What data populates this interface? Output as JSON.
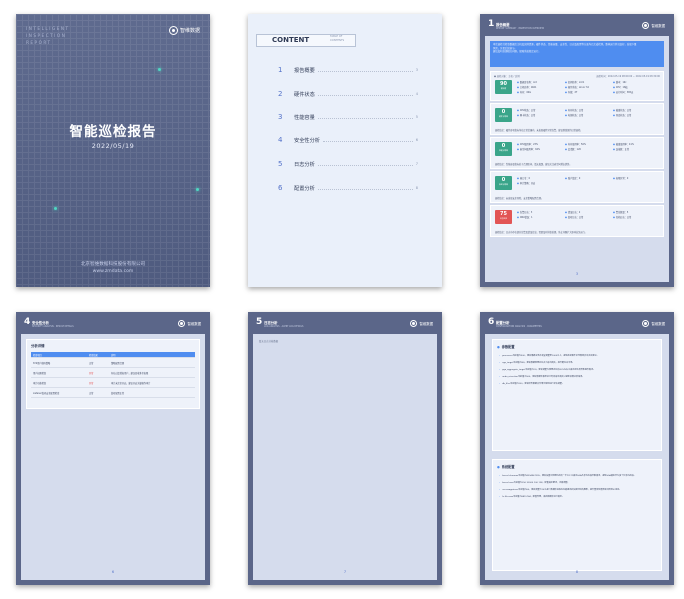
{
  "cover": {
    "en_lines": [
      "INTELLIGENT",
      "INSPECTION",
      "REPORT"
    ],
    "logo": "智维数据",
    "title": "智能巡检报告",
    "date": "2022/05/19",
    "company": "北京智维数据科技股份有限公司",
    "website": "www.zmdata.com"
  },
  "toc": {
    "heading": "CONTENT",
    "heading_sub": [
      "TABLE OF",
      "CONTENTS"
    ],
    "items": [
      {
        "num": "1",
        "label": "报告概要",
        "page": "3"
      },
      {
        "num": "2",
        "label": "硬件状态",
        "page": "4"
      },
      {
        "num": "3",
        "label": "性能容量",
        "page": "5"
      },
      {
        "num": "4",
        "label": "安全性分析",
        "page": "6"
      },
      {
        "num": "5",
        "label": "日志分析",
        "page": "7"
      },
      {
        "num": "6",
        "label": "配置分析",
        "page": "8"
      }
    ]
  },
  "page3": {
    "num": "1",
    "title": "报告概要",
    "subtitle": "REPORT SUMMARY · INSPECTION OVERVIEW",
    "logo": "智维数据",
    "summary": [
      "本次巡检共检查数据库主机及实例资源，硬件状态、性能容量、安全性、日志及配置等方面均已完成检测，整体运行状况良好，发现少量",
      "风险，详见后续章节。",
      "建议及时处理相关问题，保障系统稳定运行。"
    ],
    "top_line": "● 巡检对象：主机 / 实例",
    "top_right": "巡检时间：2022-05-19 08:00:00 ~ 2022-05-19 08:30:00",
    "cards": [
      {
        "badge": "90",
        "badge_label": "健康度",
        "color": "#3aa58a",
        "kv": [
          "数据库名称：orcl",
          "实例名称：orcl1",
          "版本：19c",
          "主机名称：db01",
          "操作系统：Linux 7.6",
          "CPU：16核",
          "内存：64G",
          "存储：2T",
          "运行时间：365天"
        ],
        "note": ""
      },
      {
        "badge": "0",
        "badge_label": "硬件异常数",
        "color": "#3aa58a",
        "kv": [
          "CPU状态：正常",
          "内存状态：正常",
          "磁盘状态：正常",
          "网卡状态：正常",
          "电源状态：正常",
          "风扇状态：正常"
        ],
        "note": "巡检结论：硬件各项指标均在正常范围内，未发现硬件异常告警，建议继续保持日常巡检。"
      },
      {
        "badge": "0",
        "badge_label": "性能异常数",
        "color": "#3aa58a",
        "kv": [
          "CPU使用率：23%",
          "内存使用率：56%",
          "磁盘使用率：41%",
          "表空间使用率：62%",
          "会话数：120",
          "连接数：正常"
        ],
        "note": "巡检结论：性能容量指标处于合理区间，暂无瓶颈，建议关注表空间增长趋势。"
      },
      {
        "badge": "0",
        "badge_label": "安全异常数",
        "color": "#3aa58a",
        "kv": [
          "弱口令：0",
          "账户锁定：0",
          "权限异常：0",
          "审计策略：开启"
        ],
        "note": "巡检结论：未发现安全风险，安全策略配置合理。"
      },
      {
        "badge": "75",
        "badge_label": "日志风险",
        "color": "#e25555",
        "kv": [
          "告警日志：3",
          "错误日志：2",
          "警告数量：5",
          "ORA错误：1",
          "监听日志：正常",
          "归档日志：正常"
        ],
        "note": "巡检结论：日志中存在部分告警及错误信息，需要及时排查处理，防止问题扩大影响业务运行。"
      }
    ],
    "page": "3"
  },
  "page4": {
    "num": "4",
    "title": "安全性分析",
    "subtitle": "SECURITY ANALYSIS · RESULT DETAILS",
    "logo": "智维数据",
    "table_title": "分析详情",
    "columns": [
      "检查项目",
      "检查结果",
      "说明"
    ],
    "rows": [
      {
        "item": "SYS用户密码策略",
        "result": "正常",
        "bad": false,
        "desc": "策略配置合理"
      },
      {
        "item": "用户权限检查",
        "result": "异常",
        "bad": true,
        "desc": "存在过度授权用户，建议回收多余权限"
      },
      {
        "item": "审计功能检查",
        "result": "异常",
        "bad": true,
        "desc": "审计未完全开启，建议开启关键操作审计"
      },
      {
        "item": "Listener监听安全配置检查",
        "result": "正常",
        "bad": false,
        "desc": "监听配置正常"
      }
    ],
    "page": "6"
  },
  "page5": {
    "num": "5",
    "title": "日志分析",
    "subtitle": "LOG ANALYSIS · ALERT LOG DETAILS",
    "logo": "智维数据",
    "note": "暂无日志分析数据",
    "page": "7"
  },
  "page6": {
    "num": "6",
    "title": "配置分析",
    "subtitle": "CONFIGURATION ANALYSIS · PARAMETERS",
    "logo": "智维数据",
    "sec1_title": "参数配置",
    "sec1_lines": [
      "processes当前值为300，建议根据业务并发量调整至1000以上，避免连接数不足导致新会话无法建立。",
      "sga_target当前值为8G，建议根据物理内存大小适当调大，提升缓存命中率。",
      "pga_aggregate_target当前值为2G，建议调整为物理内存的20%左右以满足排序及哈希操作需求。",
      "undo_retention当前值为900，建议根据长事务运行时间适当调大以避免快照过旧错误。",
      "db_files当前值为200，建议结合数据文件增长规划进行评估调整。"
    ],
    "sec2_title": "系统配置",
    "sec2_lines": [
      "kernel.shmmax当前值为4294967295，建议设置为物理内存的一半以上以满足SGA共享内存段分配需求，避免SGA被拆分为多个共享内存段。",
      "kernel.sem当前值为250 32000 100 128，配置满足要求，无需调整。",
      "vm.swappiness当前值为60，建议调整为10以减少数据库进程内存被换出到交换分区的概率，提升整体性能表现并降低IO等待。",
      "fs.file-max当前值为6815744，配置合理，满足数据库运行需求。"
    ],
    "page": "8"
  }
}
